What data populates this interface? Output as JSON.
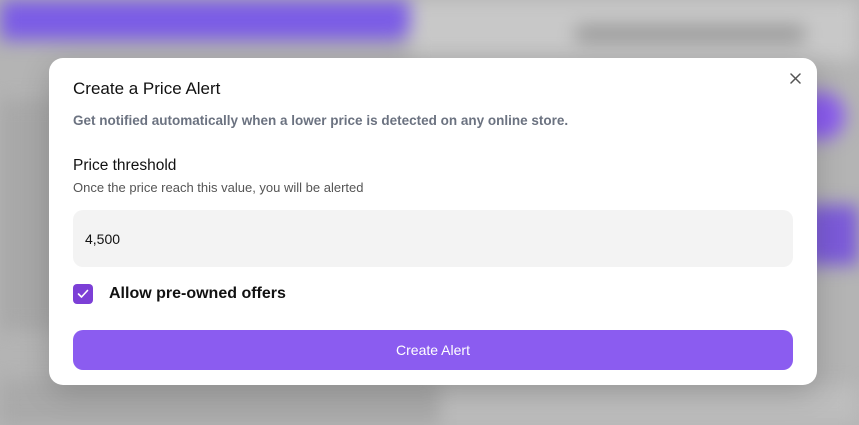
{
  "modal": {
    "title": "Create a Price Alert",
    "subtitle": "Get notified automatically when a lower price is detected on any online store.",
    "close_icon": "close-icon",
    "price_field": {
      "label": "Price threshold",
      "help": "Once the price reach this value, you will be alerted",
      "value": "4,500"
    },
    "checkbox": {
      "label": "Allow pre-owned offers",
      "checked": true,
      "icon": "check-icon"
    },
    "submit_label": "Create Alert"
  },
  "colors": {
    "accent": "#8b5cf0",
    "checkbox": "#7c3fd6",
    "input_bg": "#f3f3f3",
    "overlay": "#b4b4b4"
  }
}
